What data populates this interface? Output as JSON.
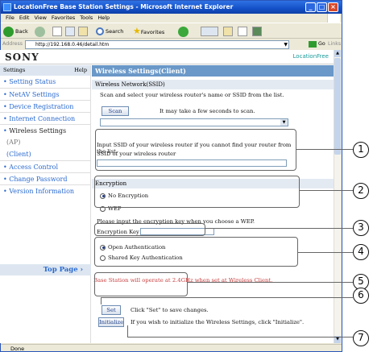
{
  "window": {
    "title": "LocationFree Base Station Settings - Microsoft Internet Explorer",
    "minimize": "_",
    "maximize": "□",
    "close": "×"
  },
  "menu": [
    "File",
    "Edit",
    "View",
    "Favorites",
    "Tools",
    "Help"
  ],
  "toolbar": {
    "back": "Back",
    "search": "Search",
    "favorites": "Favorites"
  },
  "address": {
    "label": "Address",
    "url": "http://192.168.0.46/detail.htm",
    "go": "Go",
    "links": "Links"
  },
  "header": {
    "logo": "SONY",
    "product": "LocationFree"
  },
  "sidebar": {
    "head_left": "Settings",
    "head_right": "Help",
    "items": [
      "Setting Status",
      "NetAV Settings",
      "Device Registration",
      "Internet Connection",
      "Wireless Settings"
    ],
    "sub_items": [
      "(AP)",
      "(Client)"
    ],
    "items2": [
      "Access Control",
      "Change Password",
      "Version Information"
    ],
    "top_page": "Top Page"
  },
  "main": {
    "title": "Wireless Settings(Client)",
    "network_section": "Wireless Network(SSID)",
    "scan_instruction": "Scan and select your wireless router's name or SSID from the list.",
    "scan_button": "Scan",
    "scan_note": "It may take a few seconds to scan.",
    "ssid_instruction": "Input SSID of your wireless router if you cannot find your router from the list.",
    "ssid_label": "SSID of your wireless router",
    "encryption_section": "Encryption",
    "no_encryption": "No Encryption",
    "wep": "WEP",
    "wep_instruction": "Please input the encryption key when you choose a WEP.",
    "encryption_key_label": "Encryption Key",
    "open_auth": "Open Authentication",
    "shared_auth": "Shared Key Authentication",
    "warning": "Base Station will operate at 2.4GHz when set at Wireless Client.",
    "set_button": "Set",
    "set_note": "Click \"Set\" to save changes.",
    "initialize_button": "Initialize",
    "initialize_note": "If you wish to initialize the Wireless Settings, click \"Initialize\"."
  },
  "status": {
    "text": "Done"
  },
  "callouts": [
    "1",
    "2",
    "3",
    "4",
    "5",
    "6",
    "7"
  ],
  "colors": {
    "nav_link": "#2a6ad0",
    "title_bar": "#6a98c8",
    "warning": "#c83c3c"
  }
}
